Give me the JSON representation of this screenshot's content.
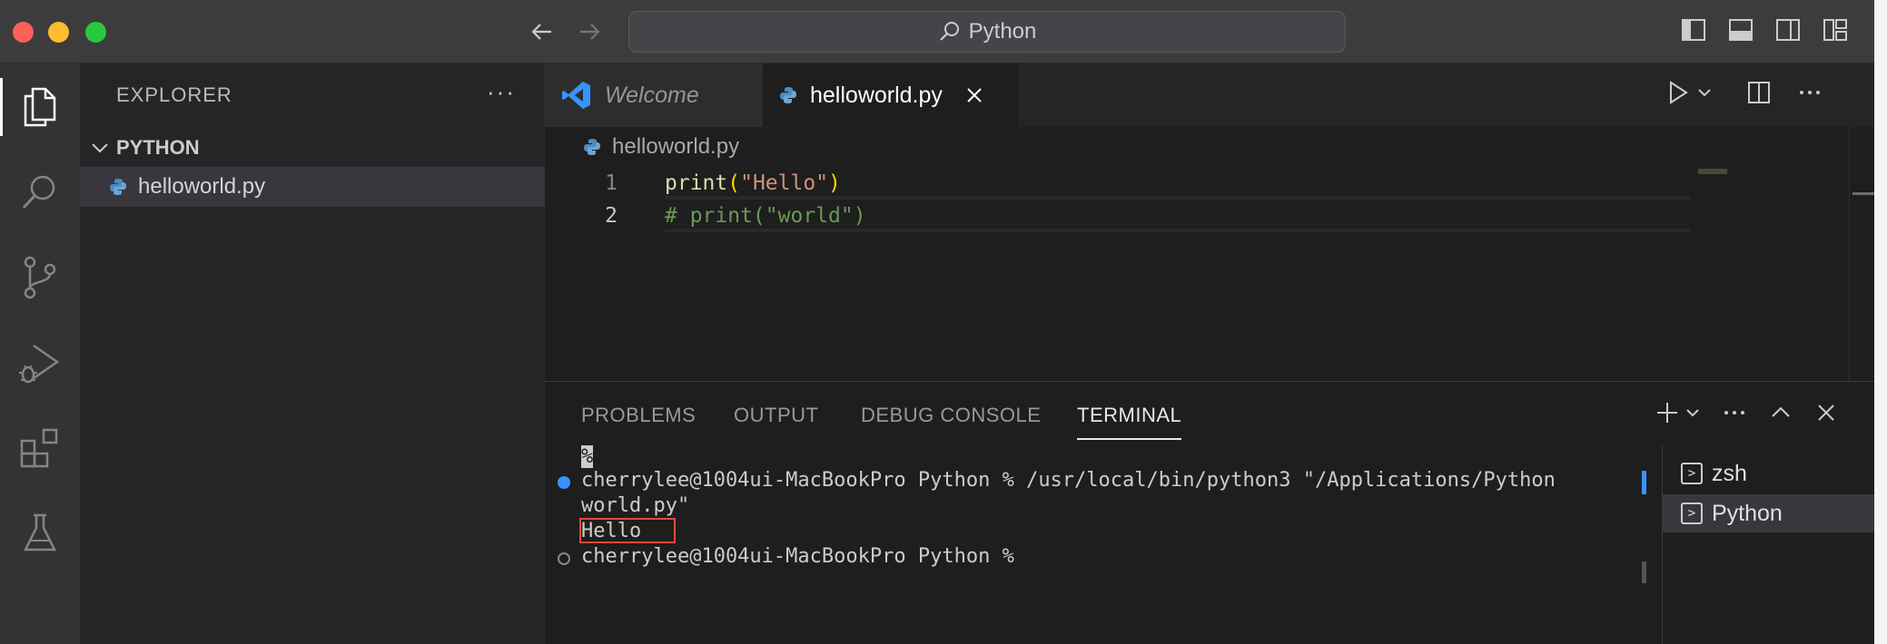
{
  "titlebar": {
    "search_text": "Python"
  },
  "sidebar": {
    "title": "EXPLORER",
    "more": "···",
    "folder": "PYTHON",
    "files": [
      "helloworld.py"
    ]
  },
  "tabs": [
    {
      "label": "Welcome",
      "active": false
    },
    {
      "label": "helloworld.py",
      "active": true
    }
  ],
  "breadcrumb": "helloworld.py",
  "editor": {
    "lines": [
      {
        "number": "1",
        "fn": "print",
        "open": "(",
        "str": "\"Hello\"",
        "close": ")"
      },
      {
        "number": "2",
        "comment": "# print(\"world\")"
      }
    ]
  },
  "panel": {
    "tabs": [
      "PROBLEMS",
      "OUTPUT",
      "DEBUG CONSOLE",
      "TERMINAL"
    ],
    "active_tab": "TERMINAL"
  },
  "terminal": {
    "prompt_marker": "%",
    "lines": [
      "cherrylee@1004ui-MacBookPro Python % /usr/local/bin/python3 \"/Applications/Python",
      "world.py\"",
      "Hello",
      "cherrylee@1004ui-MacBookPro Python %"
    ],
    "sessions": [
      "zsh",
      "Python"
    ],
    "selected_session": "Python"
  },
  "colors": {
    "accent": "#3794ff",
    "highlight_box": "#e24a3a"
  }
}
